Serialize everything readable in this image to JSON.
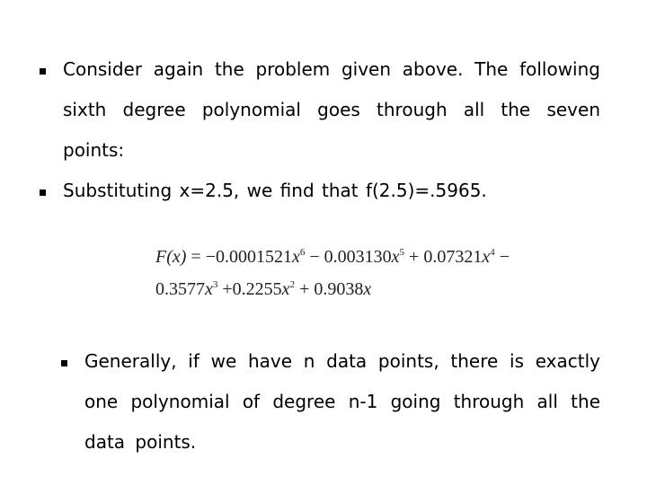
{
  "bullets": [
    {
      "text": "Consider again the problem given above. The following sixth degree polynomial goes through all the seven points:"
    },
    {
      "text": "Substituting x=2.5, we find that f(2.5)=.5965."
    },
    {
      "text": "Generally, if we have n data points, there is exactly one polynomial of degree n-1 going through all the data points."
    }
  ],
  "equation": {
    "lhs": "F(x)",
    "equals": " = ",
    "terms_line1": [
      {
        "sign": "−",
        "coef": "0.0001521",
        "var": "x",
        "exp": "6"
      },
      {
        "sign": " − ",
        "coef": "0.003130",
        "var": "x",
        "exp": "5"
      },
      {
        "sign": " + ",
        "coef": "0.07321",
        "var": "x",
        "exp": "4"
      }
    ],
    "line1_trailing": " −",
    "terms_line2": [
      {
        "sign": "",
        "coef": "0.3577",
        "var": "x",
        "exp": "3"
      },
      {
        "sign": " +",
        "coef": "0.2255",
        "var": "x",
        "exp": "2"
      },
      {
        "sign": " + ",
        "coef": "0.9038",
        "var": "x",
        "exp": ""
      }
    ]
  }
}
